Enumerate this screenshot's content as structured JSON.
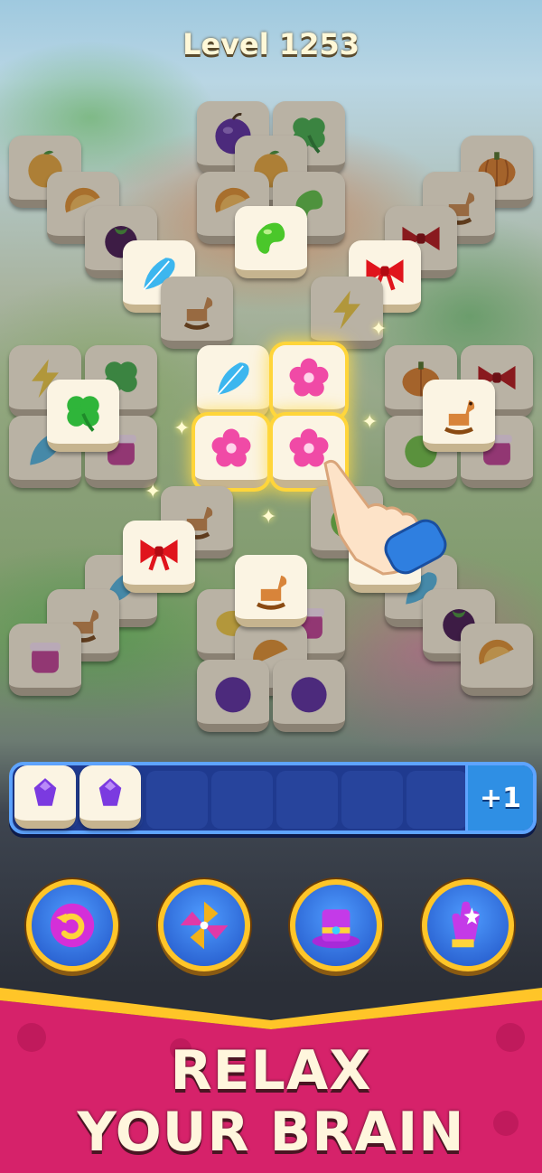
{
  "game": {
    "level_label": "Level 1253",
    "tray_bonus_label": "+1",
    "banner_line1": "RELAX",
    "banner_line2": "YOUR BRAIN"
  },
  "tray": {
    "slots_total": 7,
    "filled": [
      "gem-icon",
      "gem-icon"
    ]
  },
  "powerups": [
    "undo-icon",
    "pinwheel-shuffle-icon",
    "magic-hat-icon",
    "magic-glove-icon"
  ],
  "colors": {
    "tray_bg": "#1f3a8f",
    "tray_border": "#5ea4ff",
    "powerup_ring": "#ffc528",
    "banner": "#d6226a",
    "selection_glow": "#ffd53a"
  }
}
